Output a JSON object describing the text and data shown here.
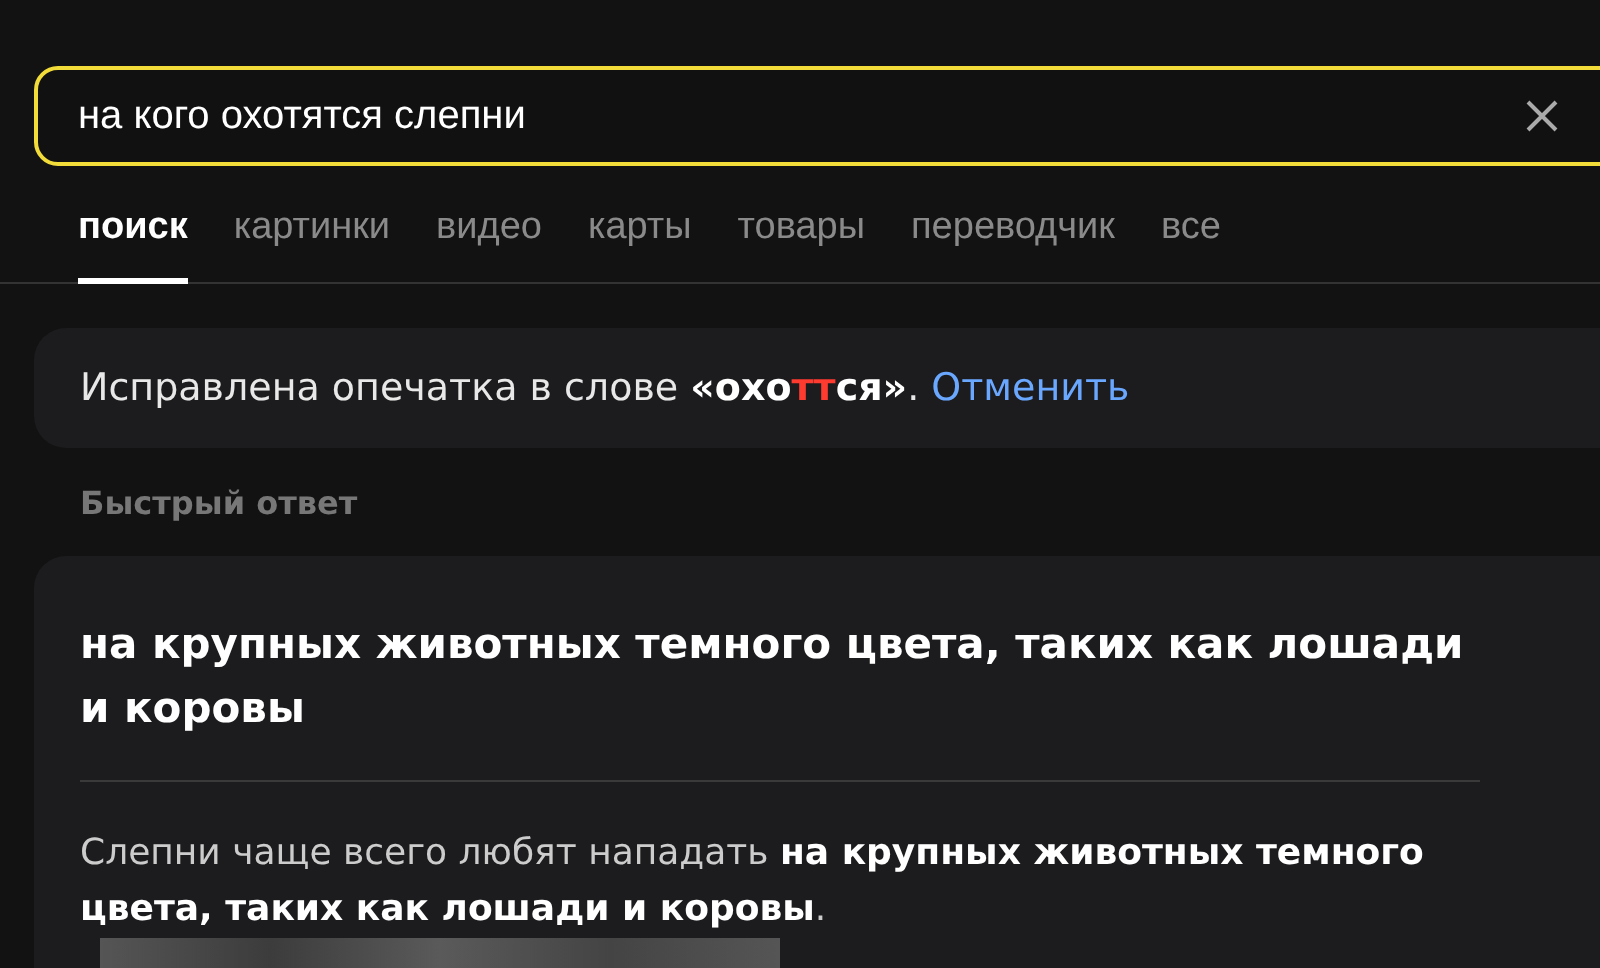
{
  "search": {
    "value": "на кого охотятся слепни"
  },
  "tabs": [
    {
      "label": "поиск",
      "selected": true
    },
    {
      "label": "картинки",
      "selected": false
    },
    {
      "label": "видео",
      "selected": false
    },
    {
      "label": "карты",
      "selected": false
    },
    {
      "label": "товары",
      "selected": false
    },
    {
      "label": "переводчик",
      "selected": false
    },
    {
      "label": "все",
      "selected": false
    }
  ],
  "correction": {
    "prefix": "Исправлена опечатка в слове ",
    "word": [
      {
        "text": "«охо",
        "highlight": false
      },
      {
        "text": "тт",
        "highlight": true
      },
      {
        "text": "ся»",
        "highlight": false
      }
    ],
    "suffix": ".",
    "link": "Отменить"
  },
  "quick_answer": {
    "heading": "Быстрый ответ",
    "title": "на крупных животных темного цвета, таких как лошади и коровы",
    "text": "Слепни чаще всего любят нападать **на крупных животных темного цвета, таких как лошади и коровы**."
  }
}
